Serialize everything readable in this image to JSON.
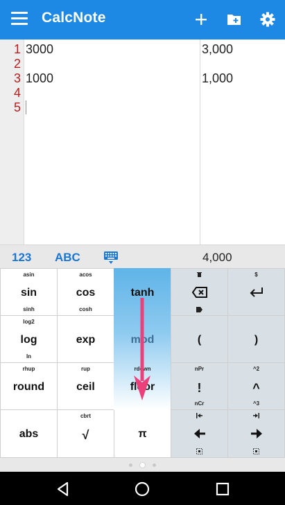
{
  "app": {
    "title": "CalcNote"
  },
  "toolbar": {
    "menu_icon": "menu-icon",
    "add_icon": "plus-icon",
    "folder_icon": "folder-add-icon",
    "settings_icon": "gear-icon"
  },
  "editor": {
    "line_numbers": [
      "1",
      "2",
      "3",
      "4",
      "5"
    ],
    "lines": [
      "3000",
      "",
      "1000",
      "",
      ""
    ],
    "results": [
      "3,000",
      "",
      "1,000",
      "",
      ""
    ]
  },
  "keyboard_header": {
    "tab_numbers": "123",
    "tab_letters": "ABC",
    "keyboard_icon": "keyboard-icon",
    "total": "4,000"
  },
  "keys": {
    "r1": [
      {
        "sup": "asin",
        "main": "sin",
        "sub": "sinh"
      },
      {
        "sup": "acos",
        "main": "cos",
        "sub": "cosh"
      },
      {
        "sup": "",
        "main": "tanh",
        "sub": ""
      },
      {
        "sup_icon": "trash-icon",
        "icon": "backspace-icon",
        "sub_icon": "delete-icon"
      },
      {
        "sup": "$",
        "icon": "enter-icon"
      }
    ],
    "r2": [
      {
        "sup": "log2",
        "main": "log",
        "sub": "ln"
      },
      {
        "main": "exp"
      },
      {
        "main": "mod"
      },
      {
        "main": "("
      },
      {
        "main": ")"
      }
    ],
    "r3": [
      {
        "sup": "rhup",
        "main": "round"
      },
      {
        "sup": "rup",
        "main": "ceil"
      },
      {
        "sup": "rdown",
        "main": "floor"
      },
      {
        "sup": "nPr",
        "main": "!",
        "sub": "nCr"
      },
      {
        "sup": "^2",
        "main": "^",
        "sub": "^3"
      }
    ],
    "r4": [
      {
        "main": "abs"
      },
      {
        "sup": "cbrt",
        "main": "√"
      },
      {
        "main": "π"
      },
      {
        "sup_icon": "jump-start-icon",
        "icon": "arrow-left-icon",
        "sub_icon": "select-icon"
      },
      {
        "sup_icon": "jump-end-icon",
        "icon": "arrow-right-icon",
        "sub_icon": "select-icon"
      }
    ]
  },
  "pager": {
    "pages": 3,
    "active": 2
  },
  "navbar": {
    "back_icon": "back-icon",
    "home_icon": "home-icon",
    "recents_icon": "recents-icon"
  }
}
